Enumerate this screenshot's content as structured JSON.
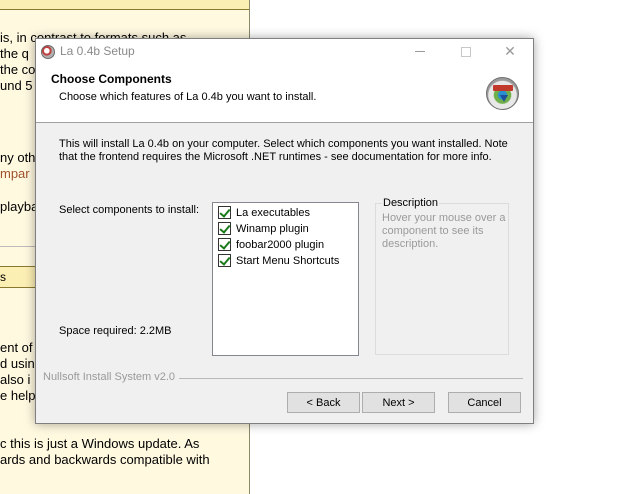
{
  "background_doc": {
    "lines_top": [
      "is, in contrast to formats such as",
      " the q",
      "the co",
      "und 5"
    ],
    "line_other": "ny oth",
    "link_text": "mpar",
    "line_playback": "playba",
    "band_label": "s",
    "lines_mid": [
      "ent of t",
      "d using",
      "also i",
      "e help"
    ],
    "lines_bottom": [
      "c this is just a Windows update. As",
      "ards and backwards compatible with"
    ]
  },
  "window": {
    "title": "La 0.4b Setup",
    "icon": "installer-disc-icon",
    "controls": {
      "minimize": "minimize-icon",
      "maximize": "maximize-icon",
      "close": "close-icon",
      "close_glyph": "✕"
    }
  },
  "header": {
    "title": "Choose Components",
    "subtitle": "Choose which features of La 0.4b you want to install.",
    "icon": "installer-disc-icon"
  },
  "body": {
    "intro_line1": "This will install La 0.4b on your computer. Select which components you want installed. Note",
    "intro_line2": "that the frontend requires the Microsoft .NET runtimes - see documentation for more info.",
    "select_label": "Select components to install:",
    "space_label": "Space required: 2.2MB"
  },
  "components": [
    {
      "label": "La executables",
      "checked": true
    },
    {
      "label": "Winamp plugin",
      "checked": true
    },
    {
      "label": "foobar2000 plugin",
      "checked": true
    },
    {
      "label": "Start Menu Shortcuts",
      "checked": true
    }
  ],
  "description": {
    "legend": "Description",
    "text": "Hover your mouse over a component to see its description."
  },
  "branding": "Nullsoft Install System v2.0",
  "buttons": {
    "back": "< Back",
    "next": "Next >",
    "cancel": "Cancel"
  },
  "colors": {
    "dialog_bg": "#f0f0f0",
    "doc_bg": "#fff9e0",
    "check": "#1a7a1a"
  }
}
